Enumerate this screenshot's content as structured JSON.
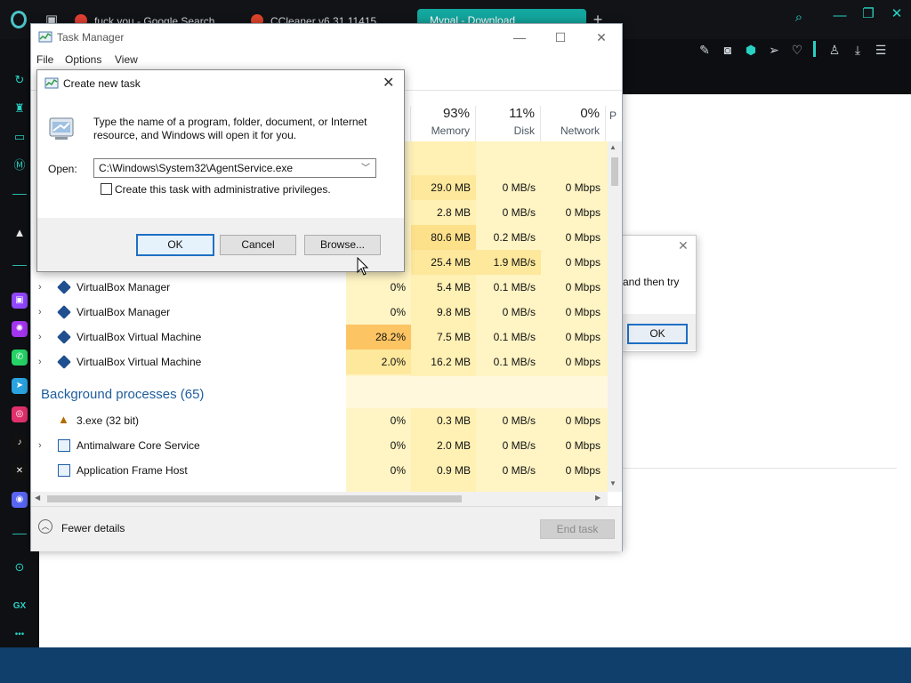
{
  "browser": {
    "tabs": [
      {
        "label": "fuck you - Google Search",
        "favicon_color": "#e34133"
      },
      {
        "label": "CCleaner v6.31.11415",
        "favicon_color": "#e0452b"
      },
      {
        "label": "Mypal - Download",
        "favicon_color": "#13a79f"
      }
    ],
    "new_tab": "+",
    "search_icon": "⌕",
    "window_controls": {
      "minimize": "—",
      "restore": "❐",
      "close": "✕"
    },
    "accent": "#29d0c4",
    "sidebar_apps": [
      {
        "name": "twitch",
        "glyph": "▣",
        "color": "#9146ff"
      },
      {
        "name": "messenger",
        "glyph": "✺",
        "color": "#a335ee"
      },
      {
        "name": "whatsapp",
        "glyph": "✆",
        "color": "#25d366"
      },
      {
        "name": "telegram",
        "glyph": "➤",
        "color": "#2aa3e0"
      },
      {
        "name": "instagram",
        "glyph": "◎",
        "color": "#e1306c"
      },
      {
        "name": "tiktok",
        "glyph": "♪",
        "color": "#111"
      },
      {
        "name": "x",
        "glyph": "✕",
        "color": "#111"
      },
      {
        "name": "discord",
        "glyph": "◉",
        "color": "#5865f2"
      }
    ],
    "gx_label": "GX",
    "more": "•••"
  },
  "task_manager": {
    "title": "Task Manager",
    "menu": [
      "File",
      "Options",
      "View"
    ],
    "columns": [
      {
        "pct": "93%",
        "name": "Memory"
      },
      {
        "pct": "11%",
        "name": "Disk"
      },
      {
        "pct": "0%",
        "name": "Network"
      },
      {
        "pct": "",
        "name": "P"
      }
    ],
    "rows_top": [
      {
        "mem": "29.0 MB",
        "disk": "0 MB/s",
        "net": "0 Mbps"
      },
      {
        "mem": "2.8 MB",
        "disk": "0 MB/s",
        "net": "0 Mbps"
      },
      {
        "mem": "80.6 MB",
        "disk": "0.2 MB/s",
        "net": "0 Mbps"
      },
      {
        "mem": "25.4 MB",
        "disk": "1.9 MB/s",
        "net": "0 Mbps"
      }
    ],
    "app_rows": [
      {
        "name": "VirtualBox Manager",
        "cpu": "0%",
        "mem": "5.4 MB",
        "disk": "0.1 MB/s",
        "net": "0 Mbps"
      },
      {
        "name": "VirtualBox Manager",
        "cpu": "0%",
        "mem": "9.8 MB",
        "disk": "0 MB/s",
        "net": "0 Mbps"
      },
      {
        "name": "VirtualBox Virtual Machine",
        "cpu": "28.2%",
        "mem": "7.5 MB",
        "disk": "0.1 MB/s",
        "net": "0 Mbps"
      },
      {
        "name": "VirtualBox Virtual Machine",
        "cpu": "2.0%",
        "mem": "16.2 MB",
        "disk": "0.1 MB/s",
        "net": "0 Mbps"
      }
    ],
    "bg_section": "Background processes (65)",
    "bg_rows": [
      {
        "name": "3.exe (32 bit)",
        "cpu": "0%",
        "mem": "0.3 MB",
        "disk": "0 MB/s",
        "net": "0 Mbps"
      },
      {
        "name": "Antimalware Core Service",
        "cpu": "0%",
        "mem": "2.0 MB",
        "disk": "0 MB/s",
        "net": "0 Mbps"
      },
      {
        "name": "Application Frame Host",
        "cpu": "0%",
        "mem": "0.9 MB",
        "disk": "0 MB/s",
        "net": "0 Mbps"
      }
    ],
    "fewer_details": "Fewer details",
    "end_task": "End task"
  },
  "bg_dialog": {
    "text": "and then try",
    "ok": "OK"
  },
  "run_dialog": {
    "title": "Create new task",
    "description": "Type the name of a program, folder, document, or Internet resource, and Windows will open it for you.",
    "open_label": "Open:",
    "open_value": "C:\\Windows\\System32\\AgentService.exe",
    "admin_checkbox": "Create this task with administrative privileges.",
    "ok": "OK",
    "cancel": "Cancel",
    "browse": "Browse..."
  }
}
